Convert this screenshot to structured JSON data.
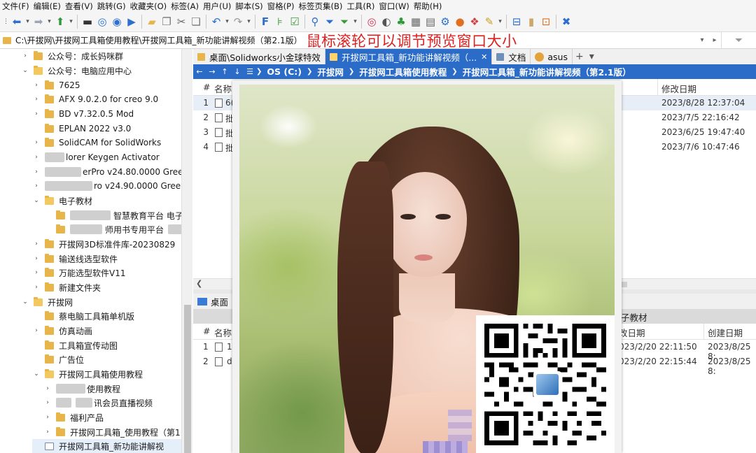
{
  "menu": [
    "文件(F)",
    "编辑(E)",
    "查看(V)",
    "跳转(G)",
    "收藏夹(O)",
    "标签(A)",
    "用户(U)",
    "脚本(S)",
    "窗格(P)",
    "标签页集(B)",
    "工具(R)",
    "窗口(W)",
    "帮助(H)"
  ],
  "path_bar": {
    "path": "C:\\开拔网\\开拔网工具箱使用教程\\开拔网工具箱_新功能讲解视频（第2.1版）",
    "overlay_text": "鼠标滚轮可以调节预览窗口大小"
  },
  "tree": [
    {
      "label": "公众号：成长妈咪群",
      "expanded": false
    },
    {
      "label": "公众号：电脑应用中心",
      "expanded": true
    },
    {
      "label": "7625",
      "expanded": false
    },
    {
      "label": "AFX 9.0.2.0 for creo 9.0",
      "expanded": false
    },
    {
      "label": "BD v7.32.0.5 Mod",
      "expanded": false
    },
    {
      "label": "EPLAN 2022 v3.0",
      "expanded": false
    },
    {
      "label": "SolidCAM for SolidWorks",
      "expanded": false
    },
    {
      "label": "lorer Keygen Activator",
      "expanded": false
    },
    {
      "label": "erPro v24.80.0000 Green",
      "expanded": false
    },
    {
      "label": "ro v24.90.0000 Green",
      "expanded": false
    },
    {
      "label": "电子教材",
      "expanded": true
    },
    {
      "label": "智慧教育平台 电子",
      "expanded": false
    },
    {
      "label": "师用书专用平台",
      "expanded": false
    },
    {
      "label": "开拔网3D标准件库-20230829",
      "expanded": false
    },
    {
      "label": "输送线选型软件",
      "expanded": false
    },
    {
      "label": "万能选型软件V11",
      "expanded": false
    },
    {
      "label": "新建文件夹",
      "expanded": false
    },
    {
      "label": "开拔网",
      "expanded": true
    },
    {
      "label": "蔡电脑工具箱单机版",
      "expanded": false
    },
    {
      "label": "仿真动画",
      "expanded": false
    },
    {
      "label": "工具箱宣传动图",
      "expanded": false
    },
    {
      "label": "广告位",
      "expanded": false
    },
    {
      "label": "开拔网工具箱使用教程",
      "expanded": true
    },
    {
      "label": "使用教程",
      "expanded": false
    },
    {
      "label": "讯会员直播视频",
      "expanded": false
    },
    {
      "label": "福利产品",
      "expanded": false
    },
    {
      "label": "开拔网工具箱_使用教程（第1",
      "expanded": false
    },
    {
      "label": "开拔网工具箱_新功能讲解视",
      "expanded": false
    }
  ],
  "tabs": [
    {
      "label": "桌面\\Solidworks小金球特效",
      "active": false
    },
    {
      "label": "开拔网工具箱_新功能讲解视频（...",
      "active": true
    },
    {
      "label": "文档",
      "active": false
    },
    {
      "label": "asus",
      "active": false
    }
  ],
  "breadcrumb": [
    "OS (C:)",
    "开拔网",
    "开拔网工具箱使用教程",
    "开拔网工具箱_新功能讲解视频（第2.1版）"
  ],
  "pane1": {
    "col_hash": "#",
    "col_name": "名称",
    "col_modified": "修改日期",
    "rows": [
      {
        "num": "1",
        "name": "6(",
        "modified": "2023/8/28 12:37:04"
      },
      {
        "num": "2",
        "name": "批",
        "modified": "2023/7/5 22:16:42"
      },
      {
        "num": "3",
        "name": "批",
        "modified": "2023/6/25 19:47:40"
      },
      {
        "num": "4",
        "name": "批",
        "modified": "2023/7/6 10:47:46"
      }
    ]
  },
  "pane2": {
    "tab": "桌面",
    "crumb_tail": "子教材",
    "col_hash": "#",
    "col_name": "名称",
    "col_modified": "改日期",
    "col_created": "创建日期",
    "rows": [
      {
        "num": "1",
        "name": "1.",
        "modified": "023/2/20 22:11:50",
        "created": "2023/8/25 8:"
      },
      {
        "num": "2",
        "name": "d",
        "modified": "023/2/20 22:15:44",
        "created": "2023/8/25 8:"
      }
    ]
  }
}
